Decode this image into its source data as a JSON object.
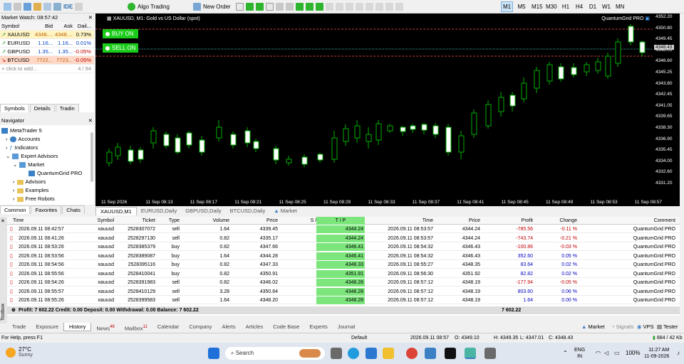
{
  "toolbar": {
    "algo_label": "Algo Trading",
    "new_order_label": "New Order",
    "timeframes": [
      "M1",
      "M5",
      "M15",
      "M30",
      "H1",
      "H4",
      "D1",
      "W1",
      "MN"
    ],
    "active_timeframe": "M1"
  },
  "market_watch": {
    "title": "Market Watch: 08:57:42",
    "headers": [
      "Symbol",
      "Bid",
      "Ask",
      "Dail..."
    ],
    "rows": [
      {
        "symbol": "XAUUSD",
        "bid": "4348....",
        "ask": "4348....",
        "daily": "0.73%",
        "dir": "up"
      },
      {
        "symbol": "EURUSD",
        "bid": "1.16...",
        "ask": "1.16...",
        "daily": "0.01%",
        "dir": "up"
      },
      {
        "symbol": "GBPUSD",
        "bid": "1.35...",
        "ask": "1.35...",
        "daily": "-0.05%",
        "dir": "up"
      },
      {
        "symbol": "BTCUSD",
        "bid": "7722...",
        "ask": "7723...",
        "daily": "-0.05%",
        "dir": "down"
      }
    ],
    "add_placeholder": "click to add...",
    "count": "4 / 94",
    "tabs": [
      "Symbols",
      "Details",
      "Tradin"
    ]
  },
  "navigator": {
    "title": "Navigator",
    "items": [
      "MetaTrader 5",
      "Accounts",
      "Indicators",
      "Expert Advisors",
      "Market",
      "QuantumGrid PRO",
      "Advisors",
      "Examples",
      "Free Robots"
    ],
    "tabs": [
      "Common",
      "Favorites",
      "Chats"
    ]
  },
  "chart": {
    "title": "XAUUSD, M1:  Gold vs US Dollar (spot)",
    "robot": "QuantumGrid PRO",
    "buy_label": "BUY ON",
    "sell_label": "SELL ON",
    "price_ticks": [
      "4352.20",
      "4350.80",
      "4349.45",
      "4348.05",
      "4346.60",
      "4345.25",
      "4343.80",
      "4342.45",
      "4341.05",
      "4339.65",
      "4338.30",
      "4336.90",
      "4335.45",
      "4334.00",
      "4332.60",
      "4331.20"
    ],
    "current_price": "4348.43",
    "time_ticks": [
      "11 Sep 2026",
      "11 Sep 08:13",
      "11 Sep 08:17",
      "11 Sep 08:21",
      "11 Sep 08:25",
      "11 Sep 08:29",
      "11 Sep 08:33",
      "11 Sep 08:37",
      "11 Sep 08:41",
      "11 Sep 08:45",
      "11 Sep 08:49",
      "11 Sep 08:53",
      "11 Sep 08:57"
    ],
    "tabs": [
      "XAUUSD,M1",
      "EURUSD,Daily",
      "GBPUSD,Daily",
      "BTCUSD,Daily",
      "Market"
    ]
  },
  "history": {
    "headers": [
      "Time",
      "Symbol",
      "Ticket",
      "Type",
      "Volume",
      "Price",
      "S / L",
      "T / P",
      "Time",
      "Price",
      "Profit",
      "Change",
      "Comment"
    ],
    "rows": [
      [
        "2026.09.11 08:42:57",
        "xauusd",
        "2528307072",
        "sell",
        "1.64",
        "4339.45",
        "",
        "4344.24",
        "2026.09.11 08:53:57",
        "4344.24",
        "-785.56",
        "-0.11 %",
        "QuantumGrid PRO"
      ],
      [
        "2026.09.11 08:41:26",
        "xauusd",
        "2528297130",
        "sell",
        "0.82",
        "4335.17",
        "",
        "4344.24",
        "2026.09.11 08:53:57",
        "4344.24",
        "-743.74",
        "-0.21 %",
        "QuantumGrid PRO"
      ],
      [
        "2026.09.11 08:53:26",
        "xauusd",
        "2528385379",
        "buy",
        "0.82",
        "4347.66",
        "",
        "4346.41",
        "2026.09.11 08:54:32",
        "4346.43",
        "-100.86",
        "-0.03 %",
        "QuantumGrid PRO"
      ],
      [
        "2026.09.11 08:53:56",
        "xauusd",
        "2528389087",
        "buy",
        "1.64",
        "4344.28",
        "",
        "4346.41",
        "2026.09.11 08:54:32",
        "4346.43",
        "352.60",
        "0.05 %",
        "QuantumGrid PRO"
      ],
      [
        "2026.09.11 08:54:56",
        "xauusd",
        "2528395116",
        "buy",
        "0.82",
        "4347.33",
        "",
        "4348.33",
        "2026.09.11 08:55:27",
        "4348.35",
        "83.64",
        "0.02 %",
        "QuantumGrid PRO"
      ],
      [
        "2026.09.11 08:55:56",
        "xauusd",
        "2528410041",
        "buy",
        "0.82",
        "4350.91",
        "",
        "4351.91",
        "2026.09.11 08:56:30",
        "4351.92",
        "82.82",
        "0.02 %",
        "QuantumGrid PRO"
      ],
      [
        "2026.09.11 08:54:26",
        "xauusd",
        "2528391983",
        "sell",
        "0.82",
        "4346.02",
        "",
        "4348.28",
        "2026.09.11 08:57:12",
        "4348.19",
        "-177.94",
        "-0.05 %",
        "QuantumGrid PRO"
      ],
      [
        "2026.09.11 08:55:57",
        "xauusd",
        "2528410129",
        "sell",
        "3.28",
        "4350.64",
        "",
        "4348.28",
        "2026.09.11 08:57:12",
        "4348.19",
        "803.60",
        "0.06 %",
        "QuantumGrid PRO"
      ],
      [
        "2026.09.11 08:55:26",
        "xauusd",
        "2528399583",
        "sell",
        "1.64",
        "4348.20",
        "",
        "4348.28",
        "2026.09.11 08:57:12",
        "4348.19",
        "1.64",
        "0.00 %",
        "QuantumGrid PRO"
      ]
    ],
    "summary": "Profit: 7 602.22  Credit: 0.00  Deposit: 0.00  Withdrawal: 0.00  Balance: 7 602.22",
    "summary_total": "7 602.22"
  },
  "bottom_tabs": [
    "Trade",
    "Exposure",
    "History",
    "News",
    "Mailbox",
    "Calendar",
    "Company",
    "Alerts",
    "Articles",
    "Code Base",
    "Experts",
    "Journal"
  ],
  "news_count": "46",
  "mailbox_count": "11",
  "right_tabs": [
    "Market",
    "Signals",
    "VPS",
    "Tester"
  ],
  "toolbox_label": "Toolbox",
  "status": {
    "help": "For Help, press F1",
    "profile": "Default",
    "datetime": "2026.09.11 08:57",
    "open": "O: 4349.10",
    "high": "H: 4349.35",
    "low": "L: 4347.01",
    "close": "C: 4348.43",
    "traffic": "884 / 42 Kb"
  },
  "taskbar": {
    "temp": "27°C",
    "weather": "Sunny",
    "search_placeholder": "Search",
    "lang1": "ENG",
    "lang2": "IN",
    "battery": "100%",
    "time": "11:27 AM",
    "date": "11-09-2026"
  }
}
